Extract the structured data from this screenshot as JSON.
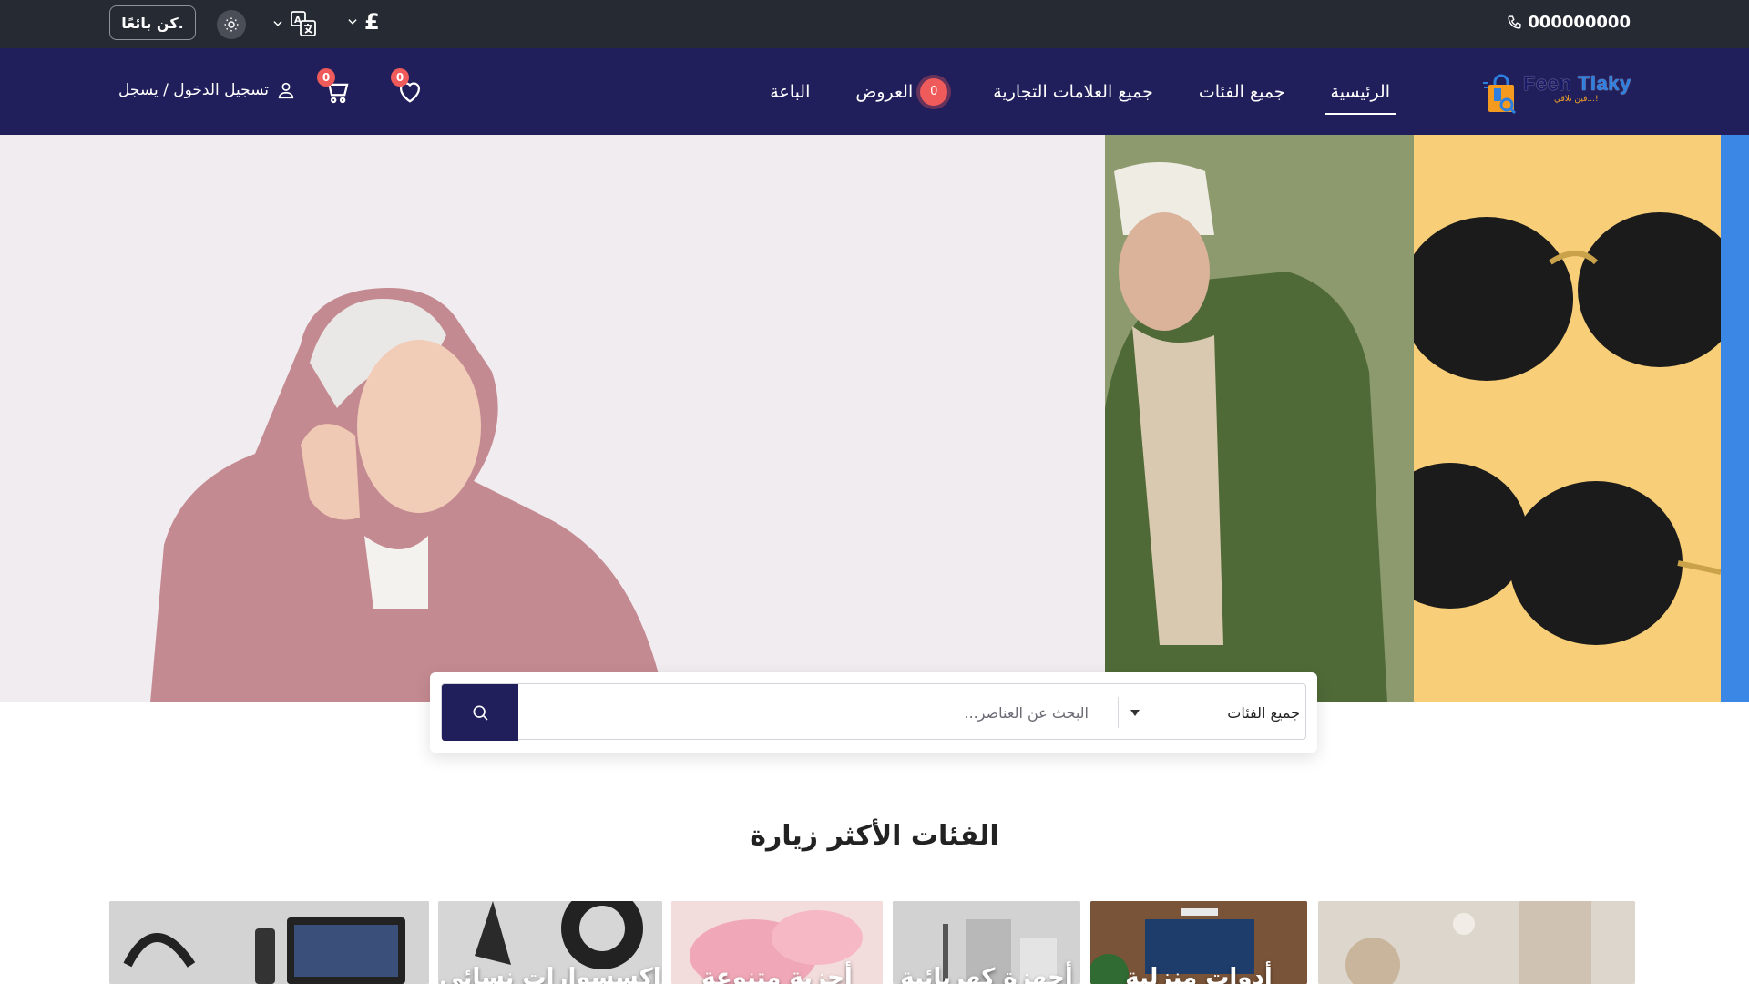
{
  "topbar": {
    "phone": "000000000",
    "become_seller": "كن بائعًا.",
    "currency_symbol": "£",
    "icons": [
      "phone-icon",
      "sun-icon",
      "translate-icon",
      "chevron-down-icon"
    ]
  },
  "brand": {
    "name_part1": "Feen ",
    "name_part2": "Tlaky",
    "tagline": "فين تلاقي...!"
  },
  "nav": {
    "home": "الرئيسية",
    "all_categories": "جميع الفئات",
    "all_brands": "جميع العلامات التجارية",
    "offers": "العروض",
    "offers_count": "0",
    "sellers": "الباعة"
  },
  "actions": {
    "login_register": "تسجيل الدخول / يسجل",
    "cart_count": "0",
    "wishlist_count": "0"
  },
  "search": {
    "placeholder": "البحث عن العناصر...",
    "category_selected": "جميع الفئات"
  },
  "sections": {
    "most_visited_title": "الفئات الأكثر زيارة",
    "categories": [
      {
        "label": ""
      },
      {
        "label": "أدوات منزلية"
      },
      {
        "label": "أجهزة كهربائية"
      },
      {
        "label": "أجزية متنوعة"
      },
      {
        "label": "إكسسوارات نسائي"
      },
      {
        "label": ""
      }
    ]
  },
  "colors": {
    "topbar_bg": "#262a33",
    "navbar_bg": "#211f5b",
    "badge": "#ef5a5a",
    "hero_panel_1": "#f1ecf0",
    "hero_panel_2": "#8d9a6d",
    "hero_panel_3": "#f8cf78",
    "hero_panel_4": "#3b87e6"
  }
}
